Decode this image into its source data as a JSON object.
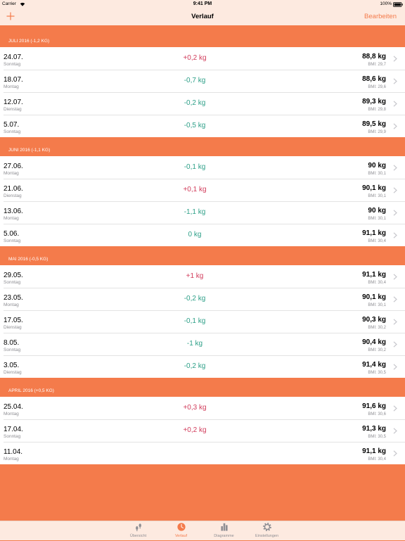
{
  "status_bar": {
    "carrier": "Carrier",
    "time": "9:41 PM",
    "battery": "100%"
  },
  "nav": {
    "title": "Verlauf",
    "edit_label": "Bearbeiten"
  },
  "sections": [
    {
      "header": "JULI 2016 (-1,2 KG)",
      "rows": [
        {
          "date": "24.07.",
          "weekday": "Sonntag",
          "change": "+0,2 kg",
          "weight": "88,8 kg",
          "bmi": "BMI: 29,7"
        },
        {
          "date": "18.07.",
          "weekday": "Montag",
          "change": "-0,7 kg",
          "weight": "88,6 kg",
          "bmi": "BMI: 29,6"
        },
        {
          "date": "12.07.",
          "weekday": "Dienstag",
          "change": "-0,2 kg",
          "weight": "89,3 kg",
          "bmi": "BMI: 29,8"
        },
        {
          "date": "5.07.",
          "weekday": "Sonntag",
          "change": "-0,5 kg",
          "weight": "89,5 kg",
          "bmi": "BMI: 29,9"
        }
      ]
    },
    {
      "header": "JUNI 2016 (-1,1 KG)",
      "rows": [
        {
          "date": "27.06.",
          "weekday": "Montag",
          "change": "-0,1 kg",
          "weight": "90 kg",
          "bmi": "BMI: 30,1"
        },
        {
          "date": "21.06.",
          "weekday": "Dienstag",
          "change": "+0,1 kg",
          "weight": "90,1 kg",
          "bmi": "BMI: 30,1"
        },
        {
          "date": "13.06.",
          "weekday": "Montag",
          "change": "-1,1 kg",
          "weight": "90 kg",
          "bmi": "BMI: 30,1"
        },
        {
          "date": "5.06.",
          "weekday": "Sonntag",
          "change": "0 kg",
          "weight": "91,1 kg",
          "bmi": "BMI: 30,4"
        }
      ]
    },
    {
      "header": "MAI 2016 (-0,5 KG)",
      "rows": [
        {
          "date": "29.05.",
          "weekday": "Sonntag",
          "change": "+1 kg",
          "weight": "91,1 kg",
          "bmi": "BMI: 30,4"
        },
        {
          "date": "23.05.",
          "weekday": "Montag",
          "change": "-0,2 kg",
          "weight": "90,1 kg",
          "bmi": "BMI: 30,1"
        },
        {
          "date": "17.05.",
          "weekday": "Dienstag",
          "change": "-0,1 kg",
          "weight": "90,3 kg",
          "bmi": "BMI: 30,2"
        },
        {
          "date": "8.05.",
          "weekday": "Sonntag",
          "change": "-1 kg",
          "weight": "90,4 kg",
          "bmi": "BMI: 30,2"
        },
        {
          "date": "3.05.",
          "weekday": "Dienstag",
          "change": "-0,2 kg",
          "weight": "91,4 kg",
          "bmi": "BMI: 30,5"
        }
      ]
    },
    {
      "header": "APRIL 2016 (+0,5 KG)",
      "rows": [
        {
          "date": "25.04.",
          "weekday": "Montag",
          "change": "+0,3 kg",
          "weight": "91,6 kg",
          "bmi": "BMI: 30,6"
        },
        {
          "date": "17.04.",
          "weekday": "Sonntag",
          "change": "+0,2 kg",
          "weight": "91,3 kg",
          "bmi": "BMI: 30,5"
        },
        {
          "date": "11.04.",
          "weekday": "Montag",
          "weight": "91,1 kg",
          "bmi": "BMI: 30,4"
        }
      ]
    }
  ],
  "tab_bar": {
    "tabs": [
      {
        "label": "Übersicht",
        "icon": "footprints-icon",
        "active": false
      },
      {
        "label": "Verlauf",
        "icon": "clock-icon",
        "active": true
      },
      {
        "label": "Diagramme",
        "icon": "bar-chart-icon",
        "active": false
      },
      {
        "label": "Einstellungen",
        "icon": "gear-icon",
        "active": false
      }
    ]
  },
  "icons": {
    "add": "add-icon",
    "wifi": "wifi-icon",
    "battery": "battery-icon",
    "row_disclosure": "chevron-right-icon"
  },
  "colors": {
    "accent": "#f47b4b",
    "bar_background": "#fdeae0",
    "increase": "#d13c5b",
    "decrease": "#2c9f87",
    "secondary_text": "#8e8e93"
  }
}
